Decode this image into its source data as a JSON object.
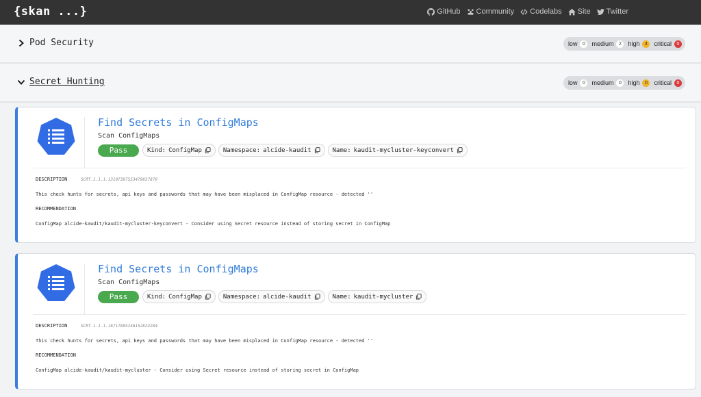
{
  "brand": "{skan ...}",
  "nav": [
    {
      "label": "GitHub",
      "icon": "github-icon"
    },
    {
      "label": "Community",
      "icon": "community-icon"
    },
    {
      "label": "Codelabs",
      "icon": "code-icon"
    },
    {
      "label": "Site",
      "icon": "home-icon"
    },
    {
      "label": "Twitter",
      "icon": "twitter-icon"
    }
  ],
  "sections": [
    {
      "title": "Pod Security",
      "expanded": false,
      "severity": {
        "low_label": "low",
        "low": "0",
        "medium_label": "medium",
        "medium": "2",
        "high_label": "high",
        "high": "4",
        "critical_label": "critical",
        "critical": "0"
      }
    },
    {
      "title": "Secret Hunting",
      "expanded": true,
      "severity": {
        "low_label": "low",
        "low": "0",
        "medium_label": "medium",
        "medium": "0",
        "high_label": "high",
        "high": "0",
        "critical_label": "critical",
        "critical": "0"
      }
    }
  ],
  "cards": [
    {
      "title": "Find Secrets in ConfigMaps",
      "subtitle": "Scan ConfigMaps",
      "status": "Pass",
      "kind_label": "Kind:",
      "kind": "ConfigMap",
      "namespace_label": "Namespace:",
      "namespace": "alcide-kaudit",
      "name_label": "Name:",
      "name": "kaudit-mycluster-keyconvert",
      "description_label": "DESCRIPTION",
      "rule_id": "SCRT.1.1.1.13107397553479837870",
      "description": "This check hunts for secrets, api keys and passwords that may have been misplaced in ConfigMap resource - detected ''",
      "recommendation_label": "RECOMMENDATION",
      "recommendation": "ConfigMap alcide-kaudit/kaudit-mycluster-keyconvert - Consider using Secret resource instead of storing secret in ConfigMap"
    },
    {
      "title": "Find Secrets in ConfigMaps",
      "subtitle": "Scan ConfigMaps",
      "status": "Pass",
      "kind_label": "Kind:",
      "kind": "ConfigMap",
      "namespace_label": "Namespace:",
      "namespace": "alcide-kaudit",
      "name_label": "Name:",
      "name": "kaudit-mycluster",
      "description_label": "DESCRIPTION",
      "rule_id": "SCRT.1.1.1.16717885246152823284",
      "description": "This check hunts for secrets, api keys and passwords that may have been misplaced in ConfigMap resource - detected ''",
      "recommendation_label": "RECOMMENDATION",
      "recommendation": "ConfigMap alcide-kaudit/kaudit-mycluster - Consider using Secret resource instead of storing secret in ConfigMap"
    }
  ],
  "colors": {
    "accent": "#2f7bd9",
    "pass": "#4aa84f",
    "topbar": "#333333",
    "high": "#f0b429",
    "critical": "#d93a3a"
  }
}
